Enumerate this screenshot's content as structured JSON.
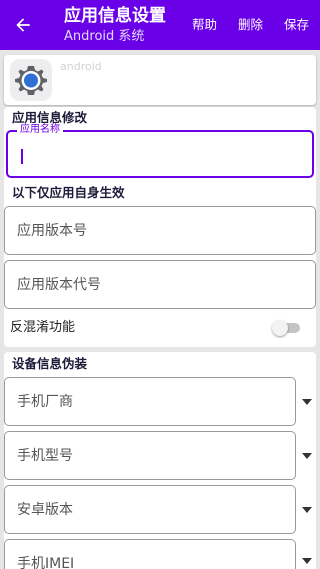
{
  "appbar": {
    "title": "应用信息设置",
    "subtitle": "Android 系统",
    "actions": {
      "help": "帮助",
      "delete": "删除",
      "save": "保存"
    }
  },
  "app": {
    "package": "android"
  },
  "info": {
    "section_title": "应用信息修改",
    "name_label": "应用名称",
    "name_value": "",
    "self_only_title": "以下仅应用自身生效",
    "version_name_placeholder": "应用版本号",
    "version_code_placeholder": "应用版本代号",
    "obfuscate_label": "反混淆功能",
    "obfuscate_on": false
  },
  "device": {
    "section_title": "设备信息伪装",
    "fields": [
      "手机厂商",
      "手机型号",
      "安卓版本",
      "手机IMEI"
    ]
  },
  "colors": {
    "accent": "#6a00e8",
    "background": "#e6e6e6"
  }
}
